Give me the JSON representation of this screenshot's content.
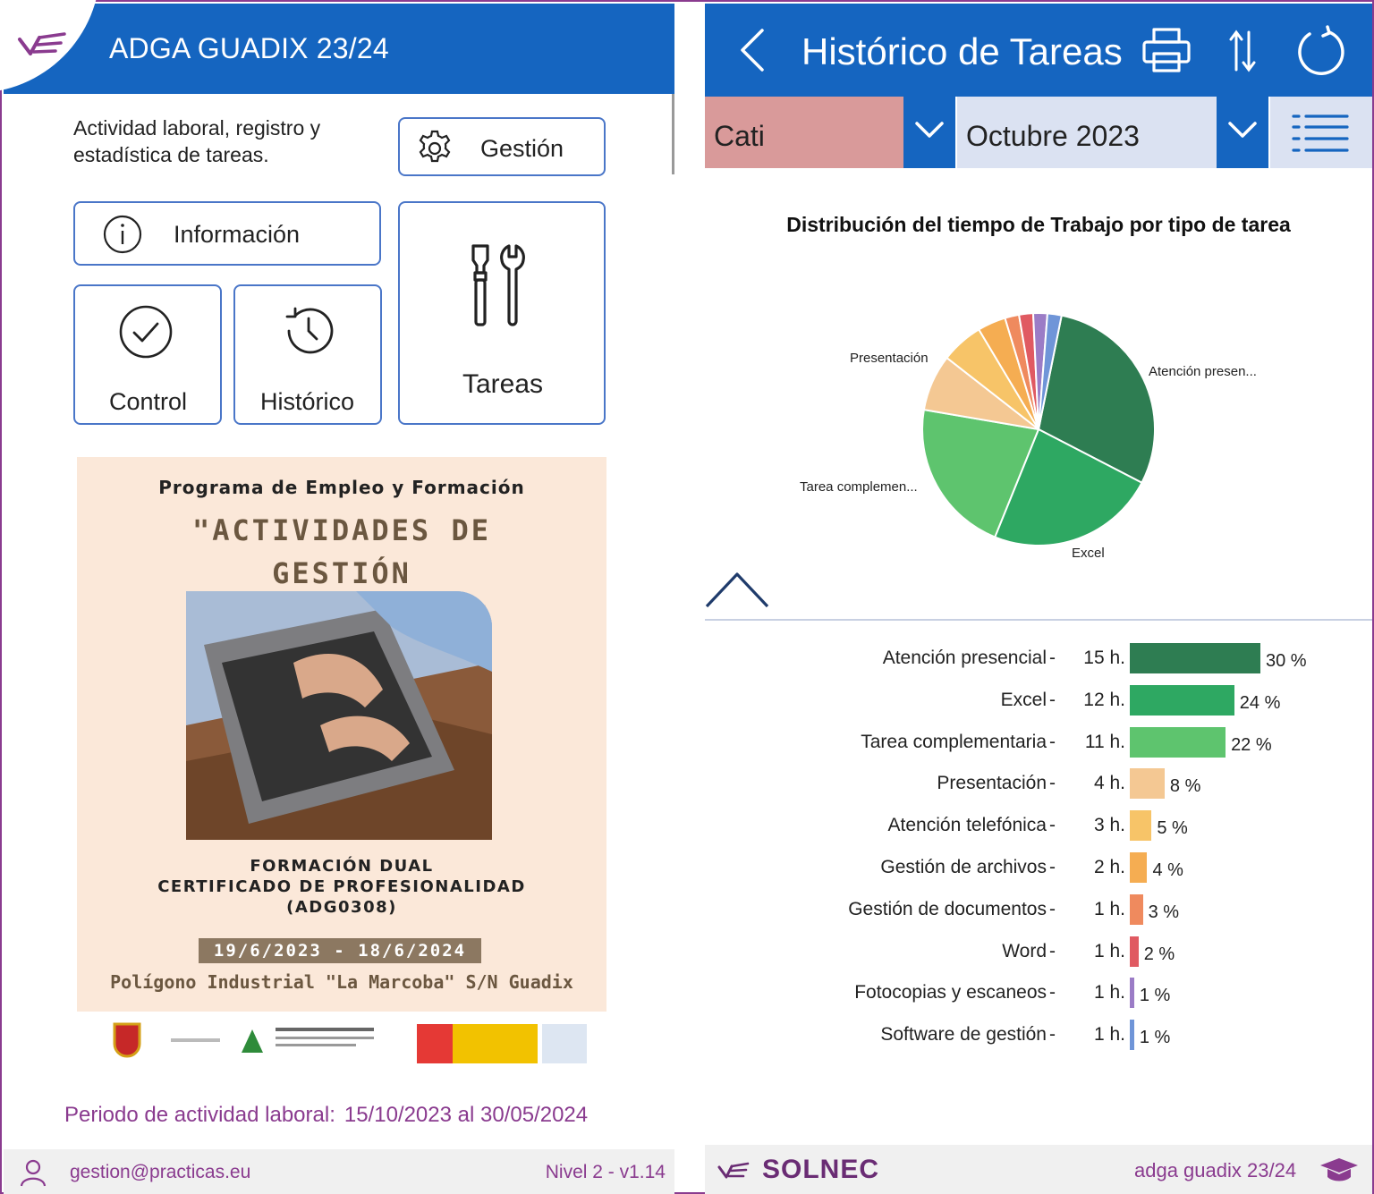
{
  "left": {
    "header": {
      "title": "ADGA GUADIX 23/24"
    },
    "description": "Actividad laboral, registro y estadística de tareas.",
    "tiles": {
      "gestion": "Gestión",
      "informacion": "Información",
      "control": "Control",
      "historico": "Histórico",
      "tareas": "Tareas"
    },
    "poster": {
      "program": "Programa de Empleo y Formación",
      "course_title": "\"ACTIVIDADES DE GESTIÓN ADMINISTRATIVA\"",
      "formacion": "FORMACIÓN DUAL",
      "certificado": "CERTIFICADO DE PROFESIONALIDAD",
      "code": "(ADG0308)",
      "dates": "19/6/2023 - 18/6/2024",
      "place": "Polígono Industrial \"La Marcoba\" S/N Guadix",
      "logos": [
        "Guadix Ayuntamiento",
        "Junta de Andalucía",
        "Ministerio de Trabajo y Economía Social",
        "SEPE"
      ]
    },
    "period": {
      "label": "Periodo de actividad laboral:",
      "value": "15/10/2023 al 30/05/2024"
    },
    "footer": {
      "user": "gestion@practicas.eu",
      "level": "Nivel 2 - v1.14"
    }
  },
  "right": {
    "header": {
      "title": "Histórico de Tareas"
    },
    "filters": {
      "person": "Cati",
      "month": "Octubre 2023"
    },
    "colors": {
      "accent": "#1565c0",
      "brand": "#8a3b8f",
      "person_filter": "#d99a9a",
      "month_filter": "#dbe2f2"
    },
    "footer": {
      "brand": "SOLNEC",
      "app": "adga guadix 23/24"
    }
  },
  "chart_data": [
    {
      "type": "pie",
      "title": "Distribución del tiempo de Trabajo por tipo de tarea",
      "slices": [
        {
          "label": "Atención presencial",
          "display_label": "Atención presen...",
          "value": 15,
          "percent": 30,
          "color": "#2e7d52"
        },
        {
          "label": "Excel",
          "display_label": "Excel",
          "value": 12,
          "percent": 24,
          "color": "#2ea862"
        },
        {
          "label": "Tarea complementaria",
          "display_label": "Tarea complemen...",
          "value": 11,
          "percent": 22,
          "color": "#5ec46e"
        },
        {
          "label": "Presentación",
          "display_label": "Presentación",
          "value": 4,
          "percent": 8,
          "color": "#f4c893"
        },
        {
          "label": "Atención telefónica",
          "value": 3,
          "percent": 5,
          "color": "#f7c468"
        },
        {
          "label": "Gestión de archivos",
          "value": 2,
          "percent": 4,
          "color": "#f5ad52"
        },
        {
          "label": "Gestión de documentos",
          "value": 1,
          "percent": 3,
          "color": "#ef8a5e"
        },
        {
          "label": "Word",
          "value": 1,
          "percent": 2,
          "color": "#e05a62"
        },
        {
          "label": "Fotocopias y escaneos",
          "value": 1,
          "percent": 1,
          "color": "#9b7cc6"
        },
        {
          "label": "Software de gestión",
          "value": 1,
          "percent": 1,
          "color": "#6f95d8"
        }
      ]
    },
    {
      "type": "bar",
      "orientation": "horizontal",
      "categories": [
        "Atención presencial",
        "Excel",
        "Tarea complementaria",
        "Presentación",
        "Atención telefónica",
        "Gestión de archivos",
        "Gestión de documentos",
        "Word",
        "Fotocopias y escaneos",
        "Software de gestión"
      ],
      "hours": [
        "15 h.",
        "12 h.",
        "11 h.",
        "4 h.",
        "3 h.",
        "2 h.",
        "1 h.",
        "1 h.",
        "1 h.",
        "1 h."
      ],
      "percents": [
        30,
        24,
        22,
        8,
        5,
        4,
        3,
        2,
        1,
        1
      ],
      "percent_labels": [
        "30 %",
        "24 %",
        "22 %",
        "8 %",
        "5 %",
        "4 %",
        "3 %",
        "2 %",
        "1 %",
        "1 %"
      ],
      "colors": [
        "#2e7d52",
        "#2ea862",
        "#5ec46e",
        "#f4c893",
        "#f7c468",
        "#f5ad52",
        "#ef8a5e",
        "#e05a62",
        "#9b7cc6",
        "#6f95d8"
      ]
    }
  ]
}
